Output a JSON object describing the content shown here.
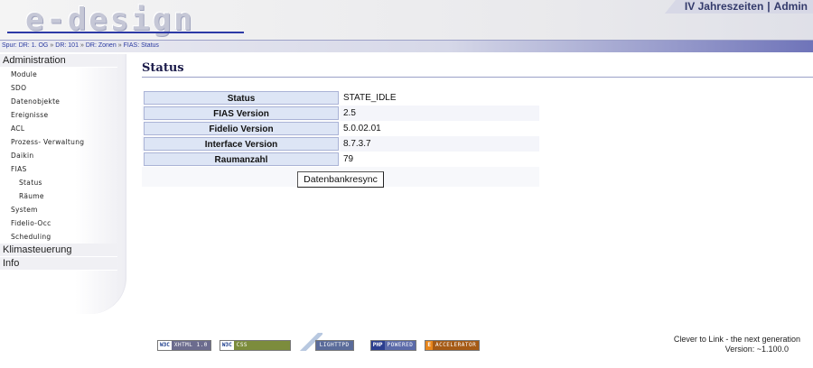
{
  "header": {
    "logo_text": "e-design",
    "location": "IV Jahreszeiten",
    "separator": "|",
    "user": "Admin"
  },
  "breadcrumb": {
    "label": "Spur:",
    "items": [
      "DR: 1. OG",
      "DR: 101",
      "DR: Zonen",
      "FIAS: Status"
    ],
    "arrow": "»"
  },
  "sidebar": {
    "administration": "Administration",
    "items": [
      "Module",
      "SDO",
      "Datenobjekte",
      "Ereignisse",
      "ACL",
      "Prozess- Verwaltung",
      "Daikin",
      "FIAS"
    ],
    "fias_sub": [
      "Status",
      "Räume"
    ],
    "items2": [
      "System",
      "Fidelio-Occ",
      "Scheduling"
    ],
    "klimasteuerung": "Klimasteuerung",
    "info": "Info"
  },
  "main": {
    "title": "Status",
    "rows": [
      {
        "label": "Status",
        "value": "STATE_IDLE"
      },
      {
        "label": "FIAS Version",
        "value": "2.5"
      },
      {
        "label": "Fidelio Version",
        "value": "5.0.02.01"
      },
      {
        "label": "Interface Version",
        "value": "8.7.3.7"
      },
      {
        "label": "Raumanzahl",
        "value": "79"
      }
    ],
    "button_label": "Datenbankresync"
  },
  "footer": {
    "badges": {
      "xhtml_l": "W3C",
      "xhtml_r": "XHTML 1.0",
      "css_l": "W3C",
      "css_r": "CSS",
      "lighttpd": "LIGHTTPD",
      "php_l": "PHP",
      "php_r": "POWERED",
      "accel_l": "E",
      "accel_r": "ACCELERATOR"
    },
    "tagline": "Clever to Link - the next generation",
    "version": "Version: ~1.100.0"
  },
  "colors": {
    "accent": "#2d3aa6",
    "label_bg": "#dde5f5",
    "title": "#1b1b4a"
  }
}
